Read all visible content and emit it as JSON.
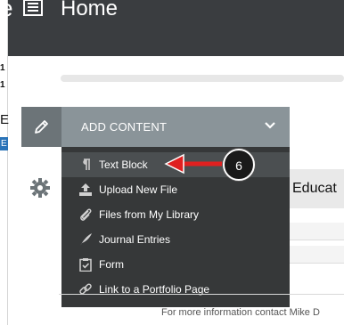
{
  "header": {
    "edge_letter": "e",
    "title": "Home"
  },
  "left_fragments": {
    "line1": "1",
    "line2": "1",
    "e_letter": "E",
    "blue_letter": "E"
  },
  "add_content": {
    "label": "ADD CONTENT"
  },
  "background": {
    "partial_heading": "Educat"
  },
  "menu": {
    "items": [
      {
        "label": "Text Block",
        "icon": "pilcrow-icon"
      },
      {
        "label": "Upload New File",
        "icon": "upload-icon"
      },
      {
        "label": "Files from My Library",
        "icon": "paperclip-icon"
      },
      {
        "label": "Journal Entries",
        "icon": "quill-icon"
      },
      {
        "label": "Form",
        "icon": "clipboard-check-icon"
      },
      {
        "label": "Link to a Portfolio Page",
        "icon": "link-icon"
      }
    ]
  },
  "annotation": {
    "step": "6"
  },
  "footer": {
    "text": "For more information contact Mike D"
  },
  "colors": {
    "header_bg": "#3a3d40",
    "add_content_bg": "#8a9499",
    "menu_bg": "#363839",
    "arrow": "#e02020"
  }
}
